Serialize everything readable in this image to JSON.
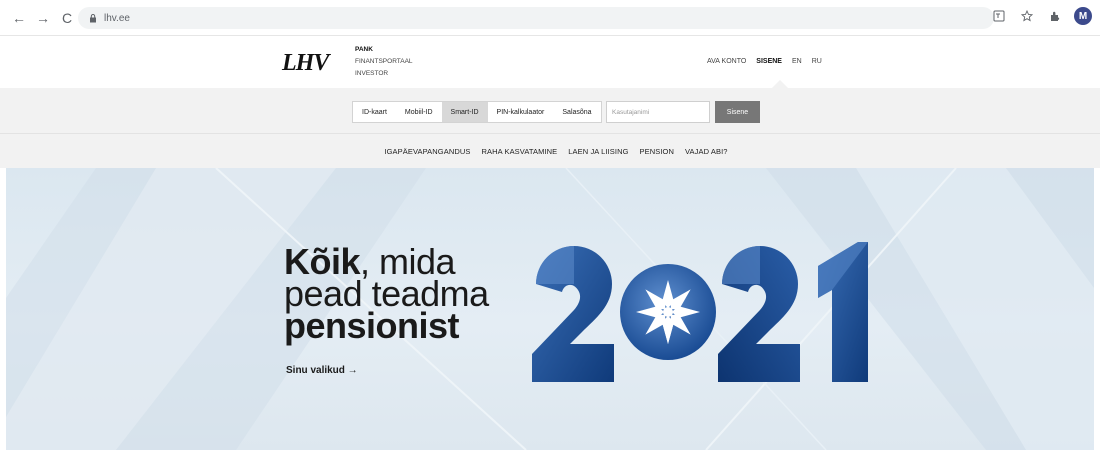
{
  "browser": {
    "url": "lhv.ee",
    "back_icon": "←",
    "forward_icon": "→",
    "reload_icon": "C",
    "profile_initial": "M"
  },
  "site": {
    "logo": "LHV",
    "portals": [
      "PANK",
      "FINANTSPORTAAL",
      "INVESTOR"
    ],
    "top_links": [
      "AVA KONTO",
      "SISENE",
      "EN",
      "RU"
    ]
  },
  "login": {
    "methods": [
      "ID-kaart",
      "Mobiil-ID",
      "Smart-ID",
      "PIN-kalkulaator",
      "Salasõna"
    ],
    "active_method": "Smart-ID",
    "username_placeholder": "Kasutajanimi",
    "submit_label": "Sisene"
  },
  "main_nav": [
    "IGAPÄEVAPANGANDUS",
    "RAHA KASVATAMINE",
    "LAEN JA LIISING",
    "PENSION",
    "VAJAD ABI?"
  ],
  "hero": {
    "line1_bold": "Kõik",
    "line1_rest": ", mida",
    "line2": "pead teadma",
    "line3": "pensionist",
    "cta": "Sinu valikud →",
    "year": "2021"
  },
  "colors": {
    "hero_blue_dark": "#0f3a7a",
    "hero_blue_light": "#3a6fb7",
    "login_button": "#777777"
  }
}
